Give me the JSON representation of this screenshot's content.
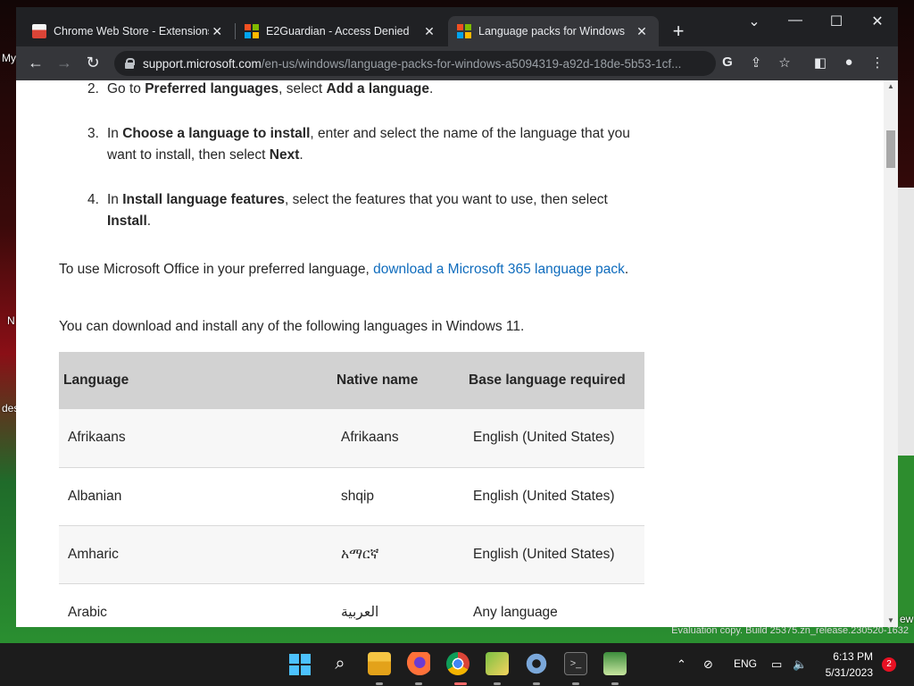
{
  "desktop": {
    "labels": [
      "My",
      "N",
      "des",
      "ew"
    ],
    "watermark": "Evaluation copy. Build 25375.zn_release.230520-1632"
  },
  "browser": {
    "tabs": [
      {
        "title": "Chrome Web Store - Extensions",
        "icon": "chrome-web-store-icon"
      },
      {
        "title": "E2Guardian - Access Denied",
        "icon": "microsoft-logo-icon"
      },
      {
        "title": "Language packs for Windows - M",
        "icon": "microsoft-logo-icon",
        "active": true
      }
    ],
    "new_tab": "+",
    "window_controls": {
      "tab_search": "⌄",
      "minimize": "—",
      "maximize": "☐",
      "close": "✕"
    },
    "url_host": "support.microsoft.com",
    "url_path": "/en-us/windows/language-packs-for-windows-a5094319-a92d-18de-5b53-1cf..."
  },
  "page": {
    "step2": {
      "num": "2.",
      "pre": "Go to ",
      "b1": "Preferred languages",
      "mid": ", select ",
      "b2": "Add a language",
      "post": "."
    },
    "step3": {
      "num": "3.",
      "pre": "In ",
      "b1": "Choose a language to install",
      "mid": ", enter and select the name of the language that you want to install, then select ",
      "b2": "Next",
      "post": "."
    },
    "step4": {
      "num": "4.",
      "pre": "In ",
      "b1": "Install language features",
      "mid": ", select the features that you want to use, then select ",
      "b2": "Install",
      "post": "."
    },
    "office_para": {
      "pre": "To use Microsoft Office in your preferred language, ",
      "link": "download a Microsoft 365 language pack",
      "post": "."
    },
    "download_para": "You can download and install any of the following languages in Windows 11.",
    "table": {
      "headers": [
        "Language",
        "Native name",
        "Base language required"
      ],
      "rows": [
        [
          "Afrikaans",
          "Afrikaans",
          "English (United States)"
        ],
        [
          "Albanian",
          "shqip",
          "English (United States)"
        ],
        [
          "Amharic",
          "አማርኛ",
          "English (United States)"
        ],
        [
          "Arabic",
          "العربية",
          "Any language"
        ]
      ]
    }
  },
  "taskbar": {
    "lang": "ENG",
    "time": "6:13 PM",
    "date": "5/31/2023",
    "notifications": "2"
  }
}
